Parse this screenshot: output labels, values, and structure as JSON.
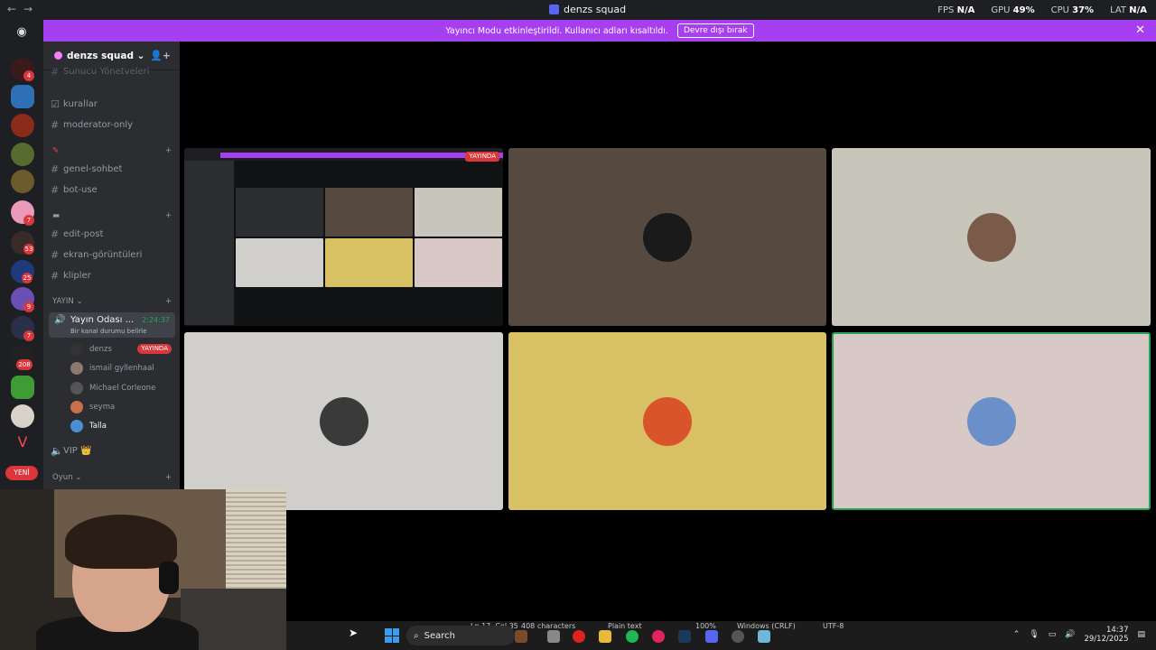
{
  "titlebar": {
    "title": "denzs squad",
    "fps_label": "FPS",
    "fps_value": "N/A",
    "gpu_label": "GPU",
    "gpu_value": "49%",
    "cpu_label": "CPU",
    "cpu_value": "37%",
    "lat_label": "LAT",
    "lat_value": "N/A"
  },
  "banner": {
    "text": "Yayıncı Modu etkinleştirildi. Kullanıcı adları kısaltıldı.",
    "button": "Devre dışı bırak",
    "close": "✕"
  },
  "rail": {
    "badges": [
      "4",
      "7",
      "53",
      "25",
      "9",
      "7",
      "208"
    ],
    "new_label": "YENİ"
  },
  "server": {
    "name": "denzs squad"
  },
  "channels": {
    "top_partial": "Sunucu Yönetveleri",
    "items_a": [
      {
        "name": "kurallar",
        "icon": "rules-icon"
      },
      {
        "name": "moderator-only",
        "icon": "hash"
      }
    ],
    "cat_b_symbol": "✎",
    "items_b": [
      "genel-sohbet",
      "bot-use"
    ],
    "cat_c_symbol": "▬",
    "items_c": [
      "edit-post",
      "ekran-görüntüleri",
      "klipler"
    ],
    "cat_yayin": "YAYIN",
    "cat_oyun": "Oyun"
  },
  "voice": {
    "channel_name": "Yayın Odası ...",
    "timer": "2:24:37",
    "status": "Bir kanal durumu belirle",
    "members": [
      {
        "name": "denzs",
        "live": "YAYINDA"
      },
      {
        "name": "ismail gyllenhaal"
      },
      {
        "name": "Michael Corleone"
      },
      {
        "name": "seyma"
      },
      {
        "name": "Talla"
      }
    ],
    "vip": "VIP 👑"
  },
  "stream_tile": {
    "live_label": "YAYINDA"
  },
  "taskbar": {
    "ln_col": "Ln 17, Col 35",
    "chars": "408 characters",
    "format": "Plain text",
    "zoom": "100%",
    "line_endings": "Windows (CRLF)",
    "encoding": "UTF-8",
    "search": "Search",
    "time": "14:37",
    "date": "29/12/2025"
  }
}
